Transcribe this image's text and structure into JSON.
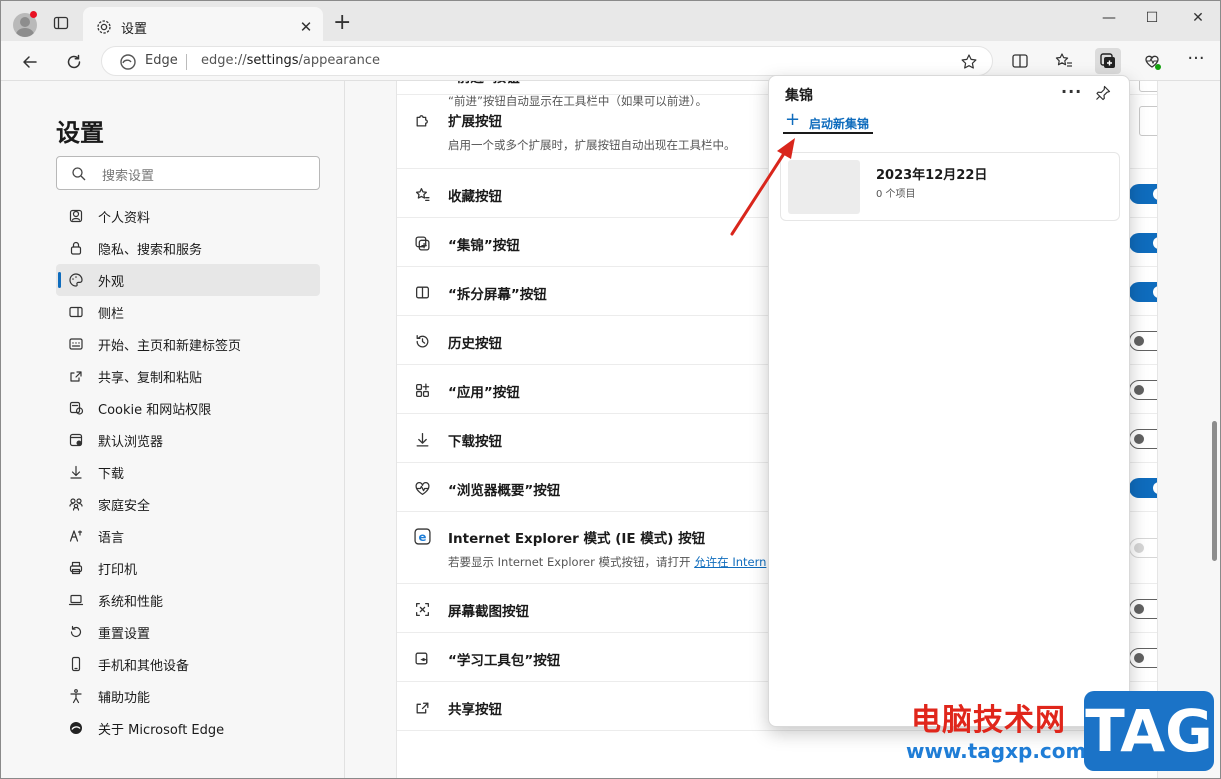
{
  "window": {
    "tab_title": "设置",
    "min_label": "—",
    "max_label": "☐",
    "close_label": "✕"
  },
  "address_bar": {
    "brand": "Edge",
    "url_prefix": "edge://",
    "url_host": "settings",
    "url_path": "/appearance"
  },
  "sidebar": {
    "heading": "设置",
    "search_placeholder": "搜索设置",
    "items": [
      {
        "label": "个人资料",
        "icon": "profile-icon"
      },
      {
        "label": "隐私、搜索和服务",
        "icon": "lock-icon"
      },
      {
        "label": "外观",
        "icon": "palette-icon",
        "active": true
      },
      {
        "label": "侧栏",
        "icon": "sidebar-icon"
      },
      {
        "label": "开始、主页和新建标签页",
        "icon": "home-icon"
      },
      {
        "label": "共享、复制和粘贴",
        "icon": "share-icon"
      },
      {
        "label": "Cookie 和网站权限",
        "icon": "cookie-icon"
      },
      {
        "label": "默认浏览器",
        "icon": "browser-icon"
      },
      {
        "label": "下载",
        "icon": "download-icon"
      },
      {
        "label": "家庭安全",
        "icon": "family-icon"
      },
      {
        "label": "语言",
        "icon": "language-icon"
      },
      {
        "label": "打印机",
        "icon": "printer-icon"
      },
      {
        "label": "系统和性能",
        "icon": "laptop-icon"
      },
      {
        "label": "重置设置",
        "icon": "reset-icon"
      },
      {
        "label": "手机和其他设备",
        "icon": "phone-icon"
      },
      {
        "label": "辅助功能",
        "icon": "accessibility-icon"
      },
      {
        "label": "关于 Microsoft Edge",
        "icon": "edge-icon"
      }
    ]
  },
  "settings": {
    "rows": [
      {
        "label": "“前进”按钮",
        "desc": "“前进”按钮自动显示在工具栏中（如果可以前进）。",
        "icon": "forward-icon",
        "control": "select"
      },
      {
        "label": "扩展按钮",
        "desc": "启用一个或多个扩展时，扩展按钮自动出现在工具栏中。",
        "icon": "puzzle-icon",
        "control": "select"
      },
      {
        "label": "收藏按钮",
        "icon": "favorites-icon",
        "control": "on"
      },
      {
        "label": "“集锦”按钮",
        "icon": "collections-icon",
        "control": "on"
      },
      {
        "label": "“拆分屏幕”按钮",
        "icon": "split-screen-icon",
        "control": "on"
      },
      {
        "label": "历史按钮",
        "icon": "history-icon",
        "control": "off"
      },
      {
        "label": "“应用”按钮",
        "icon": "apps-icon",
        "control": "off"
      },
      {
        "label": "下载按钮",
        "icon": "download-icon",
        "control": "off"
      },
      {
        "label": "“浏览器概要”按钮",
        "icon": "heartbeat-icon",
        "control": "on"
      },
      {
        "label": "Internet Explorer 模式 (IE 模式) 按钮",
        "desc": "若要显示 Internet Explorer 模式按钮，请打开 ",
        "link": "允许在 Intern",
        "icon": "ie-icon",
        "control": "disabled"
      },
      {
        "label": "屏幕截图按钮",
        "icon": "screenshot-icon",
        "control": "off"
      },
      {
        "label": "“学习工具包”按钮",
        "icon": "education-icon",
        "control": "off"
      },
      {
        "label": "共享按钮",
        "icon": "share-icon",
        "control": "none"
      }
    ]
  },
  "collections_panel": {
    "title": "集锦",
    "more_label": "···",
    "new_collection": "启动新集锦",
    "collection": {
      "date": "2023年12月22日",
      "count": "0 个项目"
    }
  },
  "watermark": {
    "text": "电脑技术网",
    "url": "www.tagxp.com",
    "logo": "TAG"
  },
  "colors": {
    "accent": "#0f6cbd",
    "arrow": "#d9261c"
  }
}
